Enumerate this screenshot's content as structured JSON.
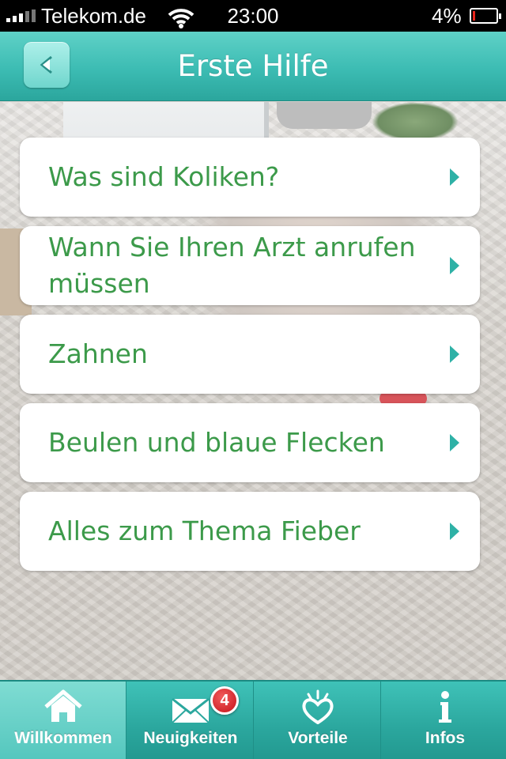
{
  "status_bar": {
    "carrier": "Telekom.de",
    "time": "23:00",
    "battery": "4%",
    "battery_level": 0.04,
    "signal_icon": "signal-bars-icon",
    "wifi_icon": "wifi-icon",
    "battery_icon": "battery-icon"
  },
  "nav_bar": {
    "title": "Erste Hilfe",
    "back_icon": "back-arrow-icon"
  },
  "menu": {
    "items": [
      {
        "label": "Was sind Koliken?"
      },
      {
        "label": "Wann Sie Ihren Arzt anrufen müssen"
      },
      {
        "label": "Zahnen"
      },
      {
        "label": "Beulen und blaue Flecken"
      },
      {
        "label": "Alles zum Thema Fieber"
      }
    ]
  },
  "tab_bar": {
    "tabs": [
      {
        "label": "Willkommen",
        "icon": "home-icon",
        "active": true
      },
      {
        "label": "Neuigkeiten",
        "icon": "mail-icon",
        "active": false
      },
      {
        "label": "Vorteile",
        "icon": "heart-icon",
        "active": false
      },
      {
        "label": "Infos",
        "icon": "info-icon",
        "active": false
      }
    ],
    "news_badge": "4"
  },
  "colors": {
    "accent": "#3cbcb3",
    "item_text": "#3c9a4a",
    "arrow": "#2eb1a6",
    "badge": "#d3212b"
  }
}
